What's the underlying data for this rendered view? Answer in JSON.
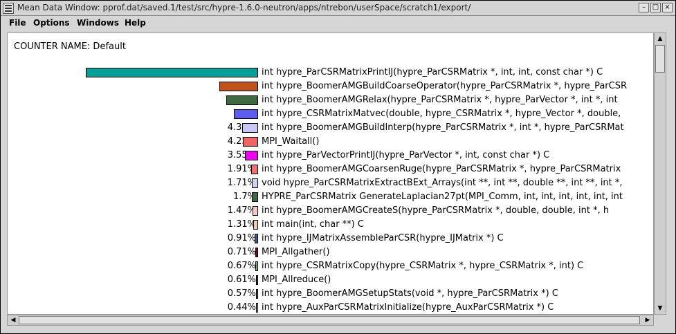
{
  "window": {
    "title": "Mean Data Window: pprof.dat/saved.1/test/src/hypre-1.6.0-neutron/apps/ntrebon/userSpace/scratch1/export/",
    "controls": {
      "minimize": "–",
      "maximize": "□",
      "close": "×"
    }
  },
  "menubar": {
    "items": [
      "File",
      "Options",
      "Windows",
      "Help"
    ]
  },
  "content": {
    "counter_label": "COUNTER NAME: Default",
    "rows": [
      {
        "pct": "47.22%",
        "value": 47.22,
        "color": "#00a098",
        "fn": "int hypre_ParCSRMatrixPrintIJ(hypre_ParCSRMatrix *, int, int, const char *) C"
      },
      {
        "pct": "10.67%",
        "value": 10.67,
        "color": "#c0521c",
        "fn": "int hypre_BoomerAMGBuildCoarseOperator(hypre_ParCSRMatrix *, hypre_ParCSR"
      },
      {
        "pct": "8.69%",
        "value": 8.69,
        "color": "#3f6a3f",
        "fn": "int hypre_BoomerAMGRelax(hypre_ParCSRMatrix *, hypre_ParVector *, int *, int"
      },
      {
        "pct": "6.7%",
        "value": 6.7,
        "color": "#5c5cf0",
        "fn": "int hypre_CSRMatrixMatvec(double, hypre_CSRMatrix *, hypre_Vector *, double,"
      },
      {
        "pct": "4.33%",
        "value": 4.33,
        "color": "#c8c8f8",
        "fn": "int hypre_BoomerAMGBuildInterp(hypre_ParCSRMatrix *, int *, hypre_ParCSRMat"
      },
      {
        "pct": "4.25%",
        "value": 4.25,
        "color": "#f06464",
        "fn": "MPI_Waitall()"
      },
      {
        "pct": "3.55%",
        "value": 3.55,
        "color": "#f000f0",
        "fn": "int hypre_ParVectorPrintIJ(hypre_ParVector *, int, const char *) C"
      },
      {
        "pct": "1.91%",
        "value": 1.91,
        "color": "#f07070",
        "fn": "int hypre_BoomerAMGCoarsenRuge(hypre_ParCSRMatrix *, hypre_ParCSRMatrix"
      },
      {
        "pct": "1.71%",
        "value": 1.71,
        "color": "#d0d0f0",
        "fn": "void hypre_ParCSRMatrixExtractBExt_Arrays(int **, int **, double **, int **, int *,"
      },
      {
        "pct": "1.7%",
        "value": 1.7,
        "color": "#3f6a3f",
        "fn": "HYPRE_ParCSRMatrix GenerateLaplacian27pt(MPI_Comm, int, int, int, int, int, int"
      },
      {
        "pct": "1.47%",
        "value": 1.47,
        "color": "#f8c8c8",
        "fn": "int hypre_BoomerAMGCreateS(hypre_ParCSRMatrix *, double, double, int *, h"
      },
      {
        "pct": "1.31%",
        "value": 1.31,
        "color": "#f8c8a8",
        "fn": "int main(int, char **) C"
      },
      {
        "pct": "0.91%",
        "value": 0.91,
        "color": "#3c5aa0",
        "fn": "int hypre_IJMatrixAssembleParCSR(hypre_IJMatrix *) C"
      },
      {
        "pct": "0.71%",
        "value": 0.71,
        "color": "#800020",
        "fn": "MPI_Allgather()"
      },
      {
        "pct": "0.67%",
        "value": 0.67,
        "color": "#70b070",
        "fn": "int hypre_CSRMatrixCopy(hypre_CSRMatrix *, hypre_CSRMatrix *, int) C"
      },
      {
        "pct": "0.61%",
        "value": 0.61,
        "color": "#2020c0",
        "fn": "MPI_Allreduce()"
      },
      {
        "pct": "0.57%",
        "value": 0.57,
        "color": "#3f7a5f",
        "fn": "int hypre_BoomerAMGSetupStats(void *, hypre_ParCSRMatrix *) C"
      },
      {
        "pct": "0.44%",
        "value": 0.44,
        "color": "#f0c090",
        "fn": "int hypre_AuxParCSRMatrixInitialize(hypre_AuxParCSRMatrix *) C"
      }
    ]
  },
  "scrollbars": {
    "vertical": {
      "up_arrow": "▲",
      "down_arrow": "▼"
    },
    "horizontal": {
      "left_arrow": "◀",
      "right_arrow": "▶"
    }
  }
}
